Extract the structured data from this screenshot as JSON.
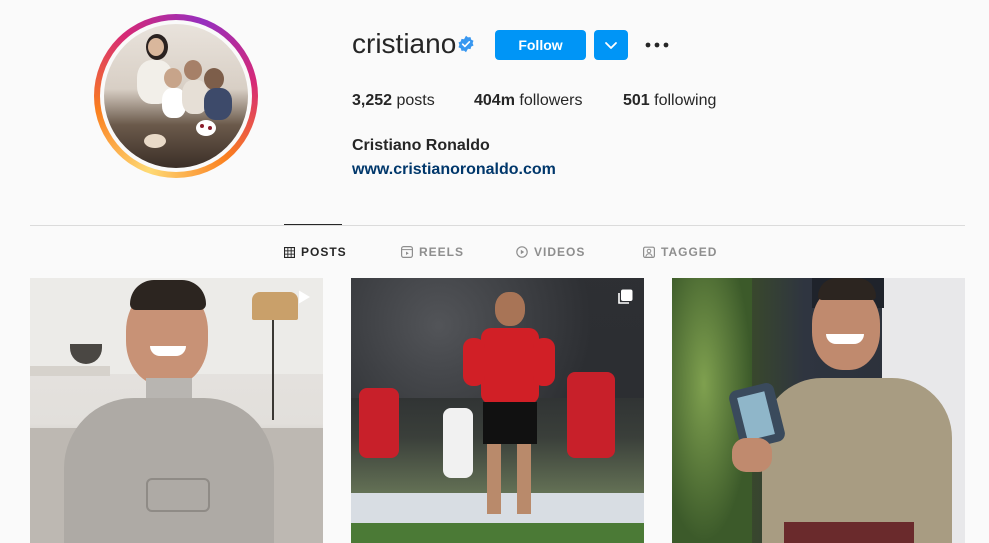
{
  "profile": {
    "username": "cristiano",
    "verified": true,
    "follow_label": "Follow",
    "fullname": "Cristiano Ronaldo",
    "website": "www.cristianoronaldo.com",
    "stats": {
      "posts_count": "3,252",
      "posts_label": " posts",
      "followers_count": "404m",
      "followers_label": " followers",
      "following_count": "501",
      "following_label": " following"
    }
  },
  "tabs": [
    {
      "label": "POSTS",
      "icon": "grid-icon",
      "active": true
    },
    {
      "label": "REELS",
      "icon": "reels-icon",
      "active": false
    },
    {
      "label": "VIDEOS",
      "icon": "video-icon",
      "active": false
    },
    {
      "label": "TAGGED",
      "icon": "tagged-icon",
      "active": false
    }
  ],
  "posts": [
    {
      "type": "reel",
      "icon": "play-icon"
    },
    {
      "type": "carousel",
      "icon": "multiple-photos-icon"
    },
    {
      "type": "photo",
      "icon": ""
    }
  ],
  "colors": {
    "accent": "#0095f6",
    "text": "#262626",
    "muted": "#8e8e8e",
    "link": "#00376b",
    "verified": "#3897f0"
  }
}
